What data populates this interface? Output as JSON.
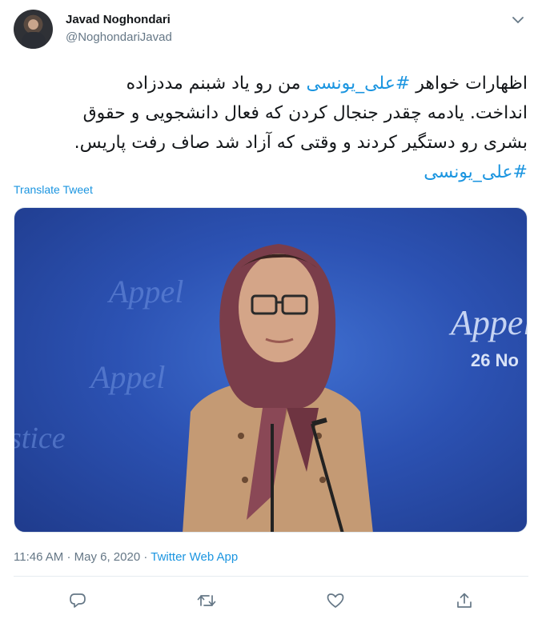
{
  "author": {
    "name": "Javad Noghondari",
    "handle": "@NoghondariJavad"
  },
  "tweet": {
    "text_lines": [
      {
        "before": "اظهارات خواهر ",
        "hashtag": "#علی_یونسی",
        "after": " من رو یاد شبنم مددزاده"
      },
      {
        "before": "انداخت. یادمه چقدر جنجال کردن که فعال دانشجویی و حقوق",
        "hashtag": "",
        "after": ""
      },
      {
        "before": "بشری رو دستگیر کردند و وقتی که آزاد شد صاف رفت پاریس.",
        "hashtag": "",
        "after": ""
      },
      {
        "before": "",
        "hashtag": "#علی_یونسی",
        "after": ""
      }
    ],
    "translate_label": "Translate Tweet"
  },
  "media": {
    "background_text_1": "Appel",
    "background_text_2": "26 No",
    "background_text_3": "Appel",
    "background_text_4": "stice",
    "background_text_5": "Appel"
  },
  "meta": {
    "time": "11:46 AM",
    "separator": "·",
    "date": "May 6, 2020",
    "source": "Twitter Web App"
  },
  "actions": [
    "reply-icon",
    "retweet-icon",
    "like-icon",
    "share-icon"
  ],
  "colors": {
    "link": "#1b95e0",
    "secondary_text": "#657786",
    "icon": "#657786"
  }
}
